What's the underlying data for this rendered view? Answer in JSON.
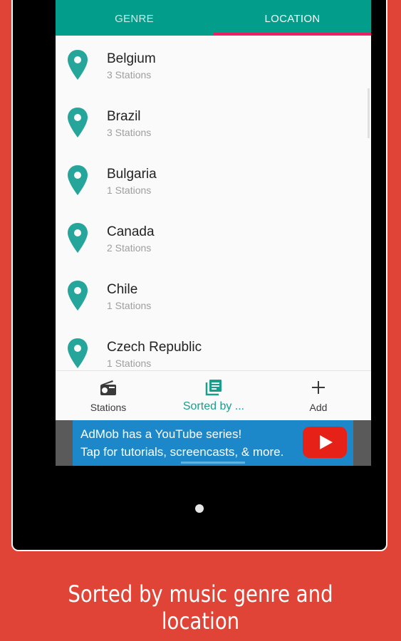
{
  "tabs": {
    "genre": {
      "label": "GENRE",
      "icon": "disc-icon"
    },
    "location": {
      "label": "LOCATION",
      "icon": "location-pin-icon"
    }
  },
  "colors": {
    "accent": "#039d8b",
    "indicator": "#e91e63",
    "background": "#df4436",
    "ad": "#1c87c9"
  },
  "locations": [
    {
      "name": "Belgium",
      "stations": "3 Stations"
    },
    {
      "name": "Brazil",
      "stations": "3 Stations"
    },
    {
      "name": "Bulgaria",
      "stations": "1 Stations"
    },
    {
      "name": "Canada",
      "stations": "2 Stations"
    },
    {
      "name": "Chile",
      "stations": "1 Stations"
    },
    {
      "name": "Czech Republic",
      "stations": "1 Stations"
    }
  ],
  "bottom_nav": {
    "stations": "Stations",
    "sorted": "Sorted by ...",
    "add": "Add"
  },
  "ad": {
    "line1": "AdMob has a YouTube series!",
    "line2": "Tap for tutorials, screencasts, & more."
  },
  "caption": "Sorted by music genre and location"
}
